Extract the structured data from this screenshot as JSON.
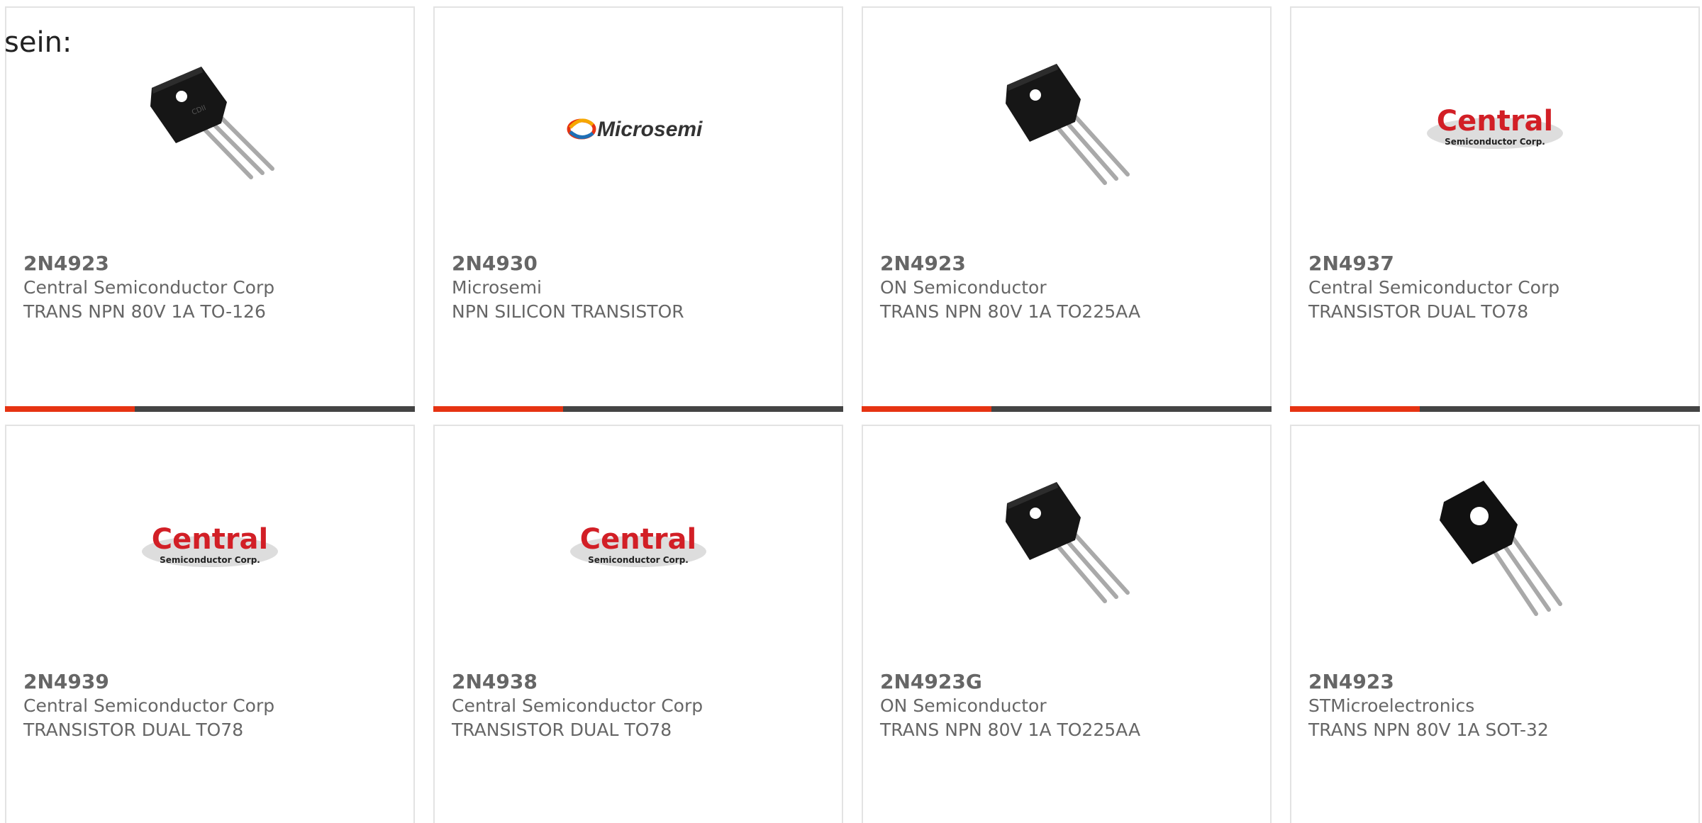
{
  "intro": "sein:",
  "colors": {
    "accent": "#e63312",
    "bar": "#444444",
    "border": "#e3e3e3",
    "text": "#666666"
  },
  "cards": [
    {
      "part": "2N4923",
      "manufacturer": "Central Semiconductor Corp",
      "description": "TRANS NPN 80V 1A TO-126",
      "image": "transistor-to126-image"
    },
    {
      "part": "2N4930",
      "manufacturer": "Microsemi",
      "description": "NPN SILICON TRANSISTOR",
      "image": "microsemi-logo",
      "logo_text": "Microsemi"
    },
    {
      "part": "2N4923",
      "manufacturer": "ON Semiconductor",
      "description": "TRANS NPN 80V 1A TO225AA",
      "image": "transistor-to225aa-image"
    },
    {
      "part": "2N4937",
      "manufacturer": "Central Semiconductor Corp",
      "description": "TRANSISTOR DUAL TO78",
      "image": "central-semiconductor-logo",
      "logo_text": "Central",
      "logo_subtext": "Semiconductor Corp."
    },
    {
      "part": "2N4939",
      "manufacturer": "Central Semiconductor Corp",
      "description": "TRANSISTOR DUAL TO78",
      "image": "central-semiconductor-logo",
      "logo_text": "Central",
      "logo_subtext": "Semiconductor Corp."
    },
    {
      "part": "2N4938",
      "manufacturer": "Central Semiconductor Corp",
      "description": "TRANSISTOR DUAL TO78",
      "image": "central-semiconductor-logo",
      "logo_text": "Central",
      "logo_subtext": "Semiconductor Corp."
    },
    {
      "part": "2N4923G",
      "manufacturer": "ON Semiconductor",
      "description": "TRANS NPN 80V 1A TO225AA",
      "image": "transistor-to225aa-image"
    },
    {
      "part": "2N4923",
      "manufacturer": "STMicroelectronics",
      "description": "TRANS NPN 80V 1A SOT-32",
      "image": "transistor-sot32-image"
    }
  ]
}
